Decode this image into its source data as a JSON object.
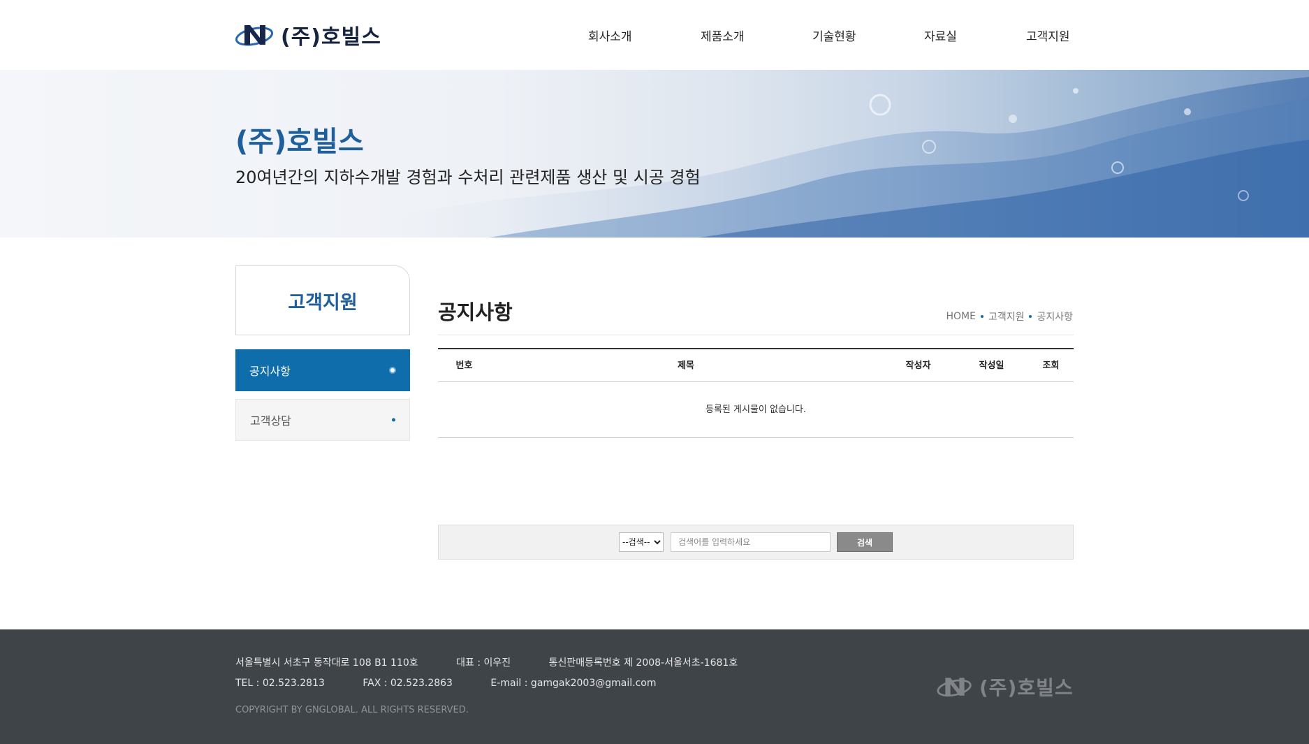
{
  "header": {
    "logo_text": "(주)호빌스",
    "nav": [
      "회사소개",
      "제품소개",
      "기술현황",
      "자료실",
      "고객지원"
    ]
  },
  "hero": {
    "title": "(주)호빌스",
    "subtitle": "20여년간의 지하수개발 경험과 수처리 관련제품 생산 및 시공 경험"
  },
  "sidebar": {
    "title": "고객지원",
    "items": [
      {
        "label": "공지사항",
        "active": true
      },
      {
        "label": "고객상담",
        "active": false
      }
    ]
  },
  "content": {
    "page_title": "공지사항",
    "breadcrumb": [
      "HOME",
      "고객지원",
      "공지사항"
    ]
  },
  "board": {
    "columns": [
      "번호",
      "제목",
      "작성자",
      "작성일",
      "조회"
    ],
    "empty_message": "등록된 게시물이 없습니다."
  },
  "search": {
    "select_value": "--검색--",
    "placeholder": "검색어를 입력하세요",
    "button_label": "검색"
  },
  "footer": {
    "address": "서울특별시 서초구 동작대로 108 B1 110호",
    "ceo": "대표 : 이우진",
    "registration": "통신판매등록번호 제 2008-서울서초-1681호",
    "tel": "TEL : 02.523.2813",
    "fax": "FAX : 02.523.2863",
    "email": "E-mail : gamgak2003@gmail.com",
    "copyright": "COPYRIGHT BY GNGLOBAL. ALL RIGHTS RESERVED.",
    "logo_text": "(주)호빌스"
  },
  "colors": {
    "brand_blue": "#0f6dab",
    "title_blue": "#1f5f9c",
    "footer_bg": "#3f4449"
  }
}
